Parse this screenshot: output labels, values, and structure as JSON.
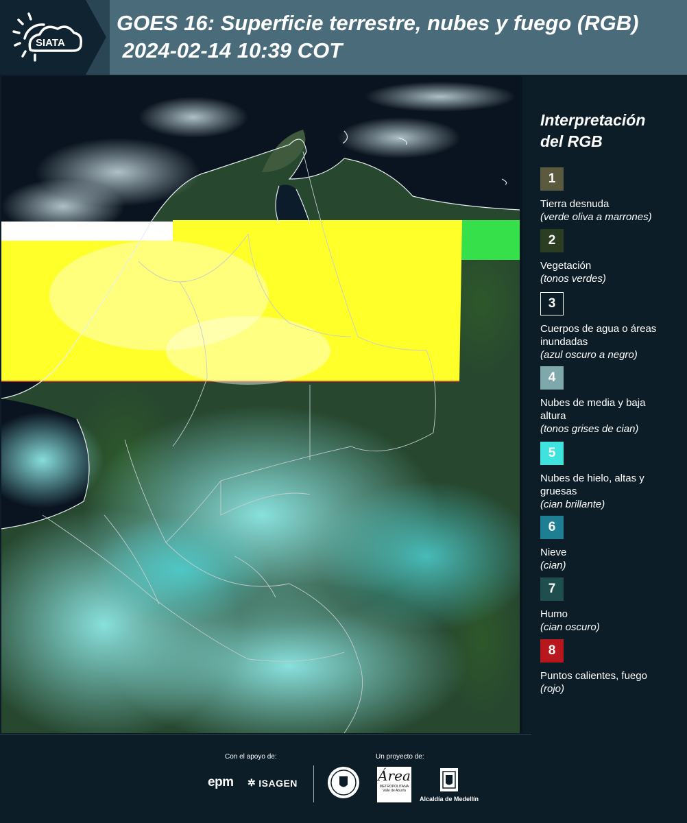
{
  "header": {
    "logo_text": "SIATA",
    "title_line1": "GOES 16: Superficie terrestre, nubes y fuego (RGB)",
    "title_line2": " 2024-02-14 10:39 COT"
  },
  "legend": {
    "title_line1": "Interpretación",
    "title_line2": "del RGB",
    "items": [
      {
        "number": "1",
        "color": "#5b5a3f",
        "label": "Tierra desnuda",
        "sub": "(verde oliva a marrones)"
      },
      {
        "number": "2",
        "color": "#2c3e22",
        "label": "Vegetación",
        "sub": "(tonos verdes)"
      },
      {
        "number": "3",
        "color": "#0c1d28",
        "label": "Cuerpos de agua o áreas inundadas",
        "sub": "(azul oscuro a negro)"
      },
      {
        "number": "4",
        "color": "#7fa8ad",
        "label": "Nubes de media y baja altura",
        "sub": "(tonos grises de cian)"
      },
      {
        "number": "5",
        "color": "#3fe2dc",
        "label": "Nubes de hielo, altas y gruesas",
        "sub": "(cian brillante)"
      },
      {
        "number": "6",
        "color": "#1e7f92",
        "label": "Nieve",
        "sub": "(cian)"
      },
      {
        "number": "7",
        "color": "#1e4e4e",
        "label": "Humo",
        "sub": "(cian oscuro)"
      },
      {
        "number": "8",
        "color": "#b8171d",
        "label": "Puntos calientes, fuego",
        "sub": "(rojo)"
      }
    ]
  },
  "footer": {
    "support_label": "Con el apoyo de:",
    "project_label": "Un proyecto de:",
    "epm": "epm",
    "isagen": "ISAGEN",
    "area_script": "Área",
    "area_name": "METROPOLITANA",
    "area_sub": "Valle de Aburrá",
    "alcaldia": "Alcaldía de Medellín"
  }
}
